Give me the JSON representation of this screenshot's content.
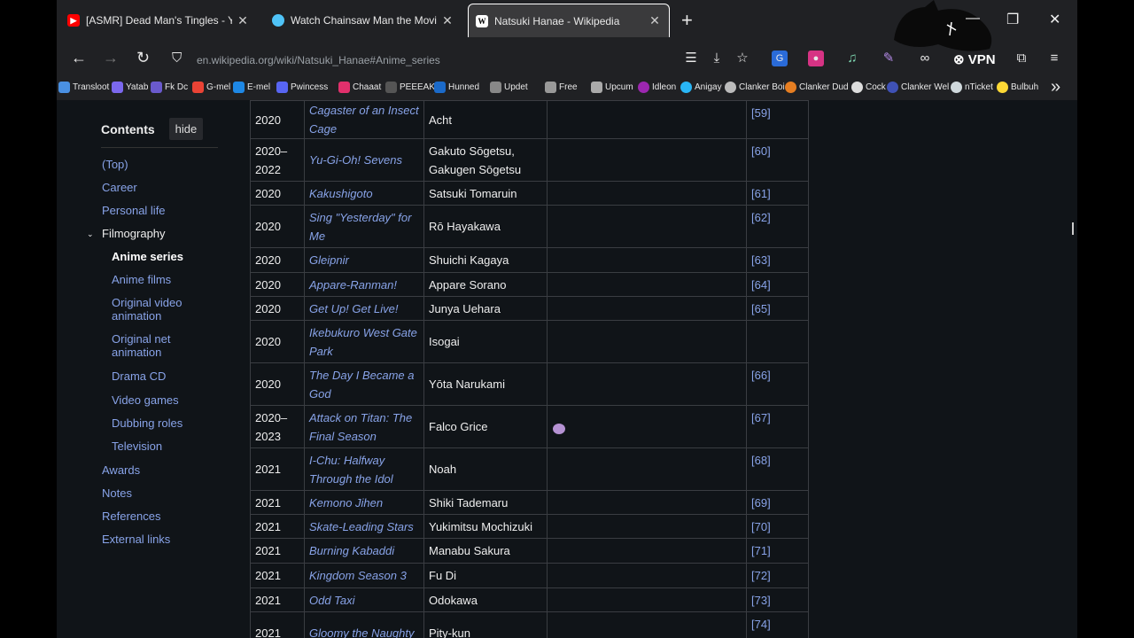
{
  "tabs": [
    {
      "title": "[ASMR] Dead Man's Tingles - YouTube",
      "icon": "youtube-icon",
      "color": "#ff0000"
    },
    {
      "title": "Watch Chainsaw Man the Movie: Reze",
      "icon": "globe-icon",
      "color": "#4fc3f7"
    },
    {
      "title": "Natsuki Hanae - Wikipedia",
      "icon": "wikipedia-icon",
      "color": "#ffffff"
    }
  ],
  "url": "en.wikipedia.org/wiki/Natsuki_Hanae#Anime_series",
  "vpn_label": "VPN",
  "bookmarks": [
    "Transloot",
    "Yatab",
    "Fk Dc",
    "G-mel",
    "E-mel",
    "Pwincess",
    "Chaaat",
    "PEEEAK",
    "Hunned",
    "Updet",
    "Free",
    "Upcum",
    "Idleon",
    "Anigay",
    "Clanker Boi",
    "Clanker Dud",
    "Cock",
    "Clanker Wel",
    "nTicket",
    "Bulbuh"
  ],
  "toc": {
    "title": "Contents",
    "hide": "hide",
    "items": [
      "(Top)",
      "Career",
      "Personal life",
      "Filmography",
      "Anime series",
      "Anime films",
      "Original video animation",
      "Original net animation",
      "Drama CD",
      "Video games",
      "Dubbing roles",
      "Television",
      "Awards",
      "Notes",
      "References",
      "External links"
    ]
  },
  "rows": [
    {
      "year": "2020",
      "title": "Cagaster of an Insect Cage",
      "role": "Acht",
      "ref": "[59]"
    },
    {
      "year": "2020–2022",
      "title": "Yu-Gi-Oh! Sevens",
      "role": "Gakuto Sōgetsu, Gakugen Sōgetsu",
      "ref": "[60]"
    },
    {
      "year": "2020",
      "title": "Kakushigoto",
      "role": "Satsuki Tomaruin",
      "ref": "[61]"
    },
    {
      "year": "2020",
      "title": "Sing \"Yesterday\" for Me",
      "role": "Rō Hayakawa",
      "ref": "[62]"
    },
    {
      "year": "2020",
      "title": "Gleipnir",
      "role": "Shuichi Kagaya",
      "ref": "[63]"
    },
    {
      "year": "2020",
      "title": "Appare-Ranman!",
      "role": "Appare Sorano",
      "ref": "[64]"
    },
    {
      "year": "2020",
      "title": "Get Up! Get Live!",
      "role": "Junya Uehara",
      "ref": "[65]"
    },
    {
      "year": "2020",
      "title": "Ikebukuro West Gate Park",
      "role": "Isogai",
      "ref": ""
    },
    {
      "year": "2020",
      "title": "The Day I Became a God",
      "role": "Yōta Narukami",
      "ref": "[66]"
    },
    {
      "year": "2020–2023",
      "title": "Attack on Titan: The Final Season",
      "role": "Falco Grice",
      "ref": "[67]"
    },
    {
      "year": "2021",
      "title": "I-Chu: Halfway Through the Idol",
      "role": "Noah",
      "ref": "[68]"
    },
    {
      "year": "2021",
      "title": "Kemono Jihen",
      "role": "Shiki Tademaru",
      "ref": "[69]"
    },
    {
      "year": "2021",
      "title": "Skate-Leading Stars",
      "role": "Yukimitsu Mochizuki",
      "ref": "[70]"
    },
    {
      "year": "2021",
      "title": "Burning Kabaddi",
      "role": "Manabu Sakura",
      "ref": "[71]"
    },
    {
      "year": "2021",
      "title": "Kingdom Season 3",
      "role": "Fu Di",
      "ref": "[72]"
    },
    {
      "year": "2021",
      "title": "Odd Taxi",
      "role": "Odokawa",
      "ref": "[73]"
    },
    {
      "year": "2021",
      "title": "Gloomy the Naughty",
      "role": "Pity-kun",
      "ref": "[74]"
    }
  ]
}
